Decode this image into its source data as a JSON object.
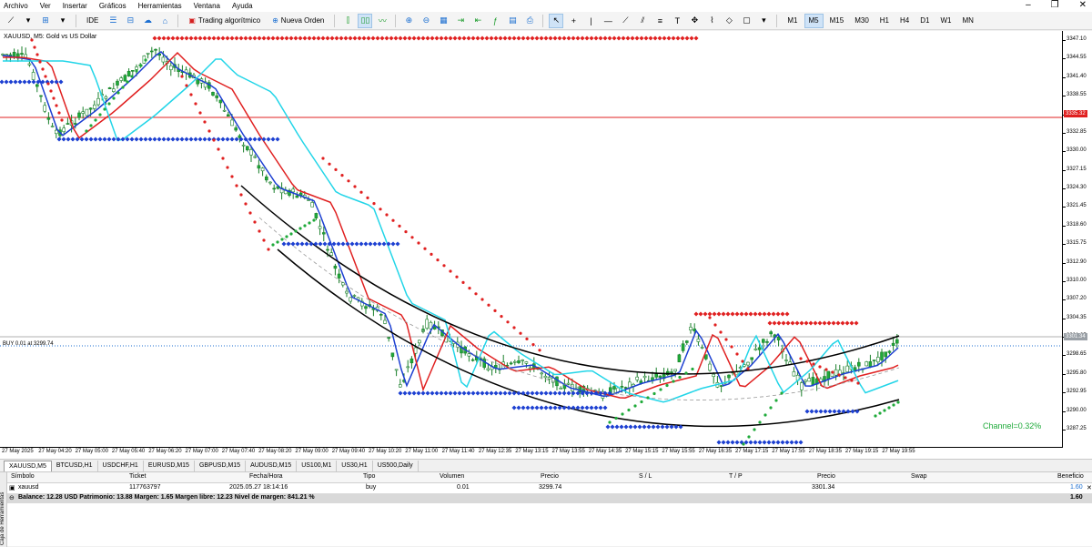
{
  "menu": [
    "Archivo",
    "Ver",
    "Insertar",
    "Gráficos",
    "Herramientas",
    "Ventana",
    "Ayuda"
  ],
  "toolbar": {
    "ide_label": "IDE",
    "algo_label": "Trading algorítmico",
    "new_order_label": "Nueva Orden",
    "timeframes": [
      "M1",
      "M5",
      "M15",
      "M30",
      "H1",
      "H4",
      "D1",
      "W1",
      "MN"
    ],
    "active_timeframe": "M5"
  },
  "chart": {
    "title": "XAUUSD, M5:  Gold vs US Dollar",
    "price_labels": [
      "3347.10",
      "3344.55",
      "3341.40",
      "3338.55",
      "3335.30",
      "3332.85",
      "3330.00",
      "3327.15",
      "3324.30",
      "3321.45",
      "3318.60",
      "3315.75",
      "3312.90",
      "3310.00",
      "3307.20",
      "3304.35",
      "3301.35",
      "3298.65",
      "3295.80",
      "3292.95",
      "3290.00",
      "3287.25"
    ],
    "time_labels": [
      "27 May 2025",
      "27 May 04:20",
      "27 May 05:00",
      "27 May 05:40",
      "27 May 06:20",
      "27 May 07:00",
      "27 May 07:40",
      "27 May 08:20",
      "27 May 09:00",
      "27 May 09:40",
      "27 May 10:20",
      "27 May 11:00",
      "27 May 11:40",
      "27 May 12:35",
      "27 May 13:15",
      "27 May 13:55",
      "27 May 14:35",
      "27 May 15:15",
      "27 May 15:55",
      "27 May 16:35",
      "27 May 17:15",
      "27 May 17:55",
      "27 May 18:35",
      "27 May 19:15",
      "27 May 19:55"
    ],
    "current_price_tag": "3301.34",
    "red_line_tag": "3335.32",
    "buy_label": "BUY 0.01 at 3299.74",
    "channel_label": "Channel=0.32%",
    "colors": {
      "bull": "#1faa3a",
      "bear": "#1faa3a",
      "ema_fast": "#1c3fd1",
      "ema_mid": "#e02020",
      "ema_slow": "#22d5e8",
      "psar_green": "#1faa3a",
      "psar_red": "#e02020",
      "channel": "#000000"
    }
  },
  "symbol_tabs": [
    "XAUUSD,M5",
    "BTCUSD,H1",
    "USDCHF,H1",
    "EURUSD,M15",
    "GBPUSD,M15",
    "AUDUSD,M15",
    "US100,M1",
    "US30,H1",
    "US500,Daily"
  ],
  "terminal": {
    "sidebar_label": "Caja de Herramientas",
    "columns": [
      "Símbolo",
      "Ticket",
      "Fecha/Hora",
      "Tipo",
      "Volumen",
      "Precio",
      "S / L",
      "T / P",
      "Precio",
      "Swap",
      "Beneficio"
    ],
    "row": {
      "symbol": "xauusd",
      "ticket": "117763797",
      "datetime": "2025.05.27 18:14:16",
      "type": "buy",
      "volume": "0.01",
      "price": "3299.74",
      "sl": "",
      "tp": "",
      "current": "3301.34",
      "swap": "",
      "profit": "1.60"
    },
    "balance_text": "Balance: 12.28 USD  Patrimonio: 13.88  Margen: 1.65  Margen libre: 12.23  Nivel de margen: 841.21 %",
    "balance_profit": "1.60"
  }
}
